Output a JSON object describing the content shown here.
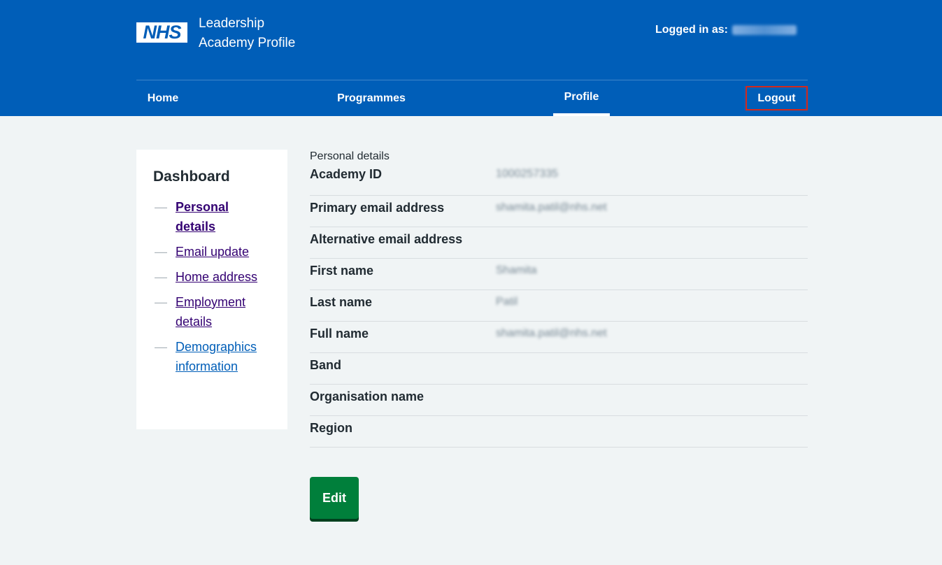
{
  "header": {
    "logo_text": "NHS",
    "service_name_line1": "Leadership",
    "service_name_line2": "Academy Profile",
    "logged_in_label": "Logged in as:",
    "logged_in_user": "1000257335"
  },
  "nav": {
    "home": "Home",
    "programmes": "Programmes",
    "profile": "Profile",
    "logout": "Logout",
    "active": "Profile"
  },
  "sidebar": {
    "title": "Dashboard",
    "items": [
      {
        "line1": "Personal",
        "line2": "details",
        "active": true
      },
      {
        "line1": "Email update",
        "line2": ""
      },
      {
        "line1": "Home address",
        "line2": ""
      },
      {
        "line1": "Employment",
        "line2": "details"
      },
      {
        "line1": "Demographics",
        "line2": "information"
      }
    ]
  },
  "details": {
    "caption": "Personal details",
    "rows": [
      {
        "key": "Academy ID",
        "value": "1000257335"
      },
      {
        "key": "Primary email address",
        "value": "shamita.patil@nhs.net"
      },
      {
        "key": "Alternative email address",
        "value": ""
      },
      {
        "key": "First name",
        "value": "Shamita"
      },
      {
        "key": "Last name",
        "value": "Patil"
      },
      {
        "key": "Full name",
        "value": "shamita.patil@nhs.net"
      },
      {
        "key": "Band",
        "value": ""
      },
      {
        "key": "Organisation name",
        "value": ""
      },
      {
        "key": "Region",
        "value": ""
      }
    ]
  },
  "actions": {
    "edit_label": "Edit"
  },
  "colors": {
    "header_blue": "#005eb8",
    "background": "#f0f4f5",
    "button_green": "#007f3b",
    "logout_outline": "#d5281b",
    "link_visited": "#330072",
    "link": "#005eb8"
  }
}
